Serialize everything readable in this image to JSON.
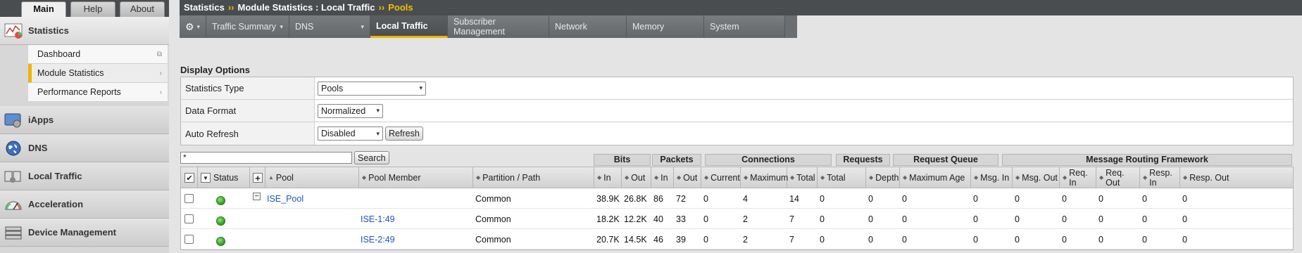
{
  "sidebar": {
    "tabs": [
      "Main",
      "Help",
      "About"
    ],
    "statistics_label": "Statistics",
    "subitems": [
      {
        "label": "Dashboard"
      },
      {
        "label": "Module Statistics"
      },
      {
        "label": "Performance Reports"
      }
    ],
    "sections": [
      {
        "label": "iApps",
        "icon": "iapps-icon"
      },
      {
        "label": "DNS",
        "icon": "dns-globe-icon"
      },
      {
        "label": "Local Traffic",
        "icon": "local-traffic-icon"
      },
      {
        "label": "Acceleration",
        "icon": "acceleration-gauge-icon"
      },
      {
        "label": "Device Management",
        "icon": "device-management-icon"
      }
    ]
  },
  "breadcrumb": {
    "part1": "Statistics",
    "sep": "››",
    "part2": "Module Statistics : Local Traffic",
    "part3": "Pools"
  },
  "tabs": [
    "Traffic Summary",
    "DNS",
    "Local Traffic",
    "Subscriber Management",
    "Network",
    "Memory",
    "System"
  ],
  "display_options": {
    "title": "Display Options",
    "statistics_type_label": "Statistics Type",
    "statistics_type_value": "Pools",
    "data_format_label": "Data Format",
    "data_format_value": "Normalized",
    "auto_refresh_label": "Auto Refresh",
    "auto_refresh_value": "Disabled",
    "refresh_button": "Refresh"
  },
  "filter": {
    "value": "*",
    "search_button": "Search"
  },
  "groups": [
    "Bits",
    "Packets",
    "Connections",
    "Requests",
    "Request Queue",
    "Message Routing Framework"
  ],
  "columns": [
    "Status",
    "Pool",
    "Pool Member",
    "Partition / Path",
    "In",
    "Out",
    "In",
    "Out",
    "Current",
    "Maximum",
    "Total",
    "Total",
    "Depth",
    "Maximum Age",
    "Msg. In",
    "Msg. Out",
    "Req. In",
    "Req. Out",
    "Resp. In",
    "Resp. Out"
  ],
  "rows": [
    {
      "pool": "ISE_Pool",
      "member": "",
      "partition": "Common",
      "bits_in": "38.9K",
      "bits_out": "26.8K",
      "pkts_in": "86",
      "pkts_out": "72",
      "conn_cur": "0",
      "conn_max": "4",
      "conn_total": "14",
      "req_total": "0",
      "rq_depth": "0",
      "rq_maxage": "0",
      "msg_in": "0",
      "msg_out": "0",
      "req_in": "0",
      "req_out": "0",
      "resp_in": "0",
      "resp_out": "0"
    },
    {
      "pool": "",
      "member": "ISE-1:49",
      "partition": "Common",
      "bits_in": "18.2K",
      "bits_out": "12.2K",
      "pkts_in": "40",
      "pkts_out": "33",
      "conn_cur": "0",
      "conn_max": "2",
      "conn_total": "7",
      "req_total": "0",
      "rq_depth": "0",
      "rq_maxage": "0",
      "msg_in": "0",
      "msg_out": "0",
      "req_in": "0",
      "req_out": "0",
      "resp_in": "0",
      "resp_out": "0"
    },
    {
      "pool": "",
      "member": "ISE-2:49",
      "partition": "Common",
      "bits_in": "20.7K",
      "bits_out": "14.5K",
      "pkts_in": "46",
      "pkts_out": "39",
      "conn_cur": "0",
      "conn_max": "2",
      "conn_total": "7",
      "req_total": "0",
      "rq_depth": "0",
      "rq_maxage": "0",
      "msg_in": "0",
      "msg_out": "0",
      "req_in": "0",
      "req_out": "0",
      "resp_in": "0",
      "resp_out": "0"
    }
  ],
  "colors": {
    "accent": "#f0b400",
    "link": "#2255bb",
    "status_green": "#2d9a1e"
  }
}
